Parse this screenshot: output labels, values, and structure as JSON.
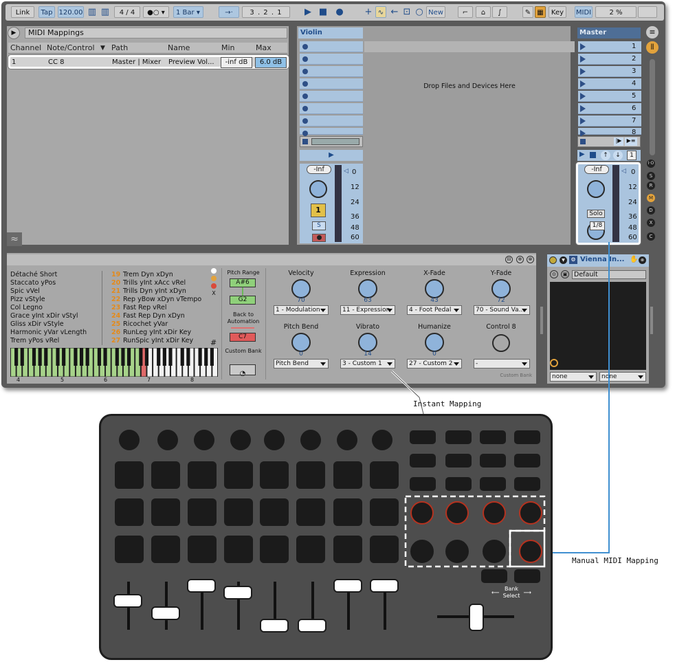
{
  "toolbar": {
    "link": "Link",
    "tap": "Tap",
    "tempo": "120.00",
    "signature": "4 / 4",
    "quantize": "1 Bar",
    "position": "3 .  2 .  1",
    "new": "New",
    "key": "Key",
    "midi": "MIDI",
    "cpu": "2 %"
  },
  "mappings": {
    "title": "MIDI Mappings",
    "columns": [
      "Channel",
      "Note/Control",
      "Path",
      "Name",
      "Min",
      "Max"
    ],
    "row": {
      "channel": "1",
      "control": "CC 8",
      "path": "Master | Mixer",
      "name": "Preview Vol...",
      "min": "-inf dB",
      "max": "6.0 dB"
    }
  },
  "violin": {
    "name": "Violin",
    "volume": "-Inf",
    "track_num": "1",
    "solo": "S",
    "db_scale": [
      "0",
      "12",
      "24",
      "36",
      "48",
      "60"
    ]
  },
  "drop_text": "Drop Files and Devices Here",
  "master": {
    "name": "Master",
    "scenes": [
      "1",
      "2",
      "3",
      "4",
      "5",
      "6",
      "7",
      "8"
    ],
    "volume": "-Inf",
    "solo": "Solo",
    "cue": "1/8",
    "io": "1",
    "db_scale": [
      "0",
      "12",
      "24",
      "36",
      "48",
      "60"
    ]
  },
  "side_letters": [
    "I·O",
    "S",
    "R",
    "M",
    "D",
    "X",
    "C"
  ],
  "articulations": {
    "left": [
      "Détaché Short",
      "Staccato yPos",
      "Spic vVel",
      "Pizz vStyle",
      "Col Legno",
      "Grace yInt xDir vStyl",
      "Gliss xDir vStyle",
      "Harmonic yVar vLength",
      "Trem yPos vRel"
    ],
    "right": [
      {
        "n": "19",
        "t": "Trem Dyn xDyn"
      },
      {
        "n": "20",
        "t": "Trills yInt xAcc vRel"
      },
      {
        "n": "21",
        "t": "Trills Dyn yInt xDyn"
      },
      {
        "n": "22",
        "t": "Rep yBow xDyn vTempo"
      },
      {
        "n": "23",
        "t": "Fast Rep vRel"
      },
      {
        "n": "24",
        "t": "Fast Rep Dyn xDyn"
      },
      {
        "n": "25",
        "t": "Ricochet yVar"
      },
      {
        "n": "26",
        "t": "RunLeg yInt xDir Key"
      },
      {
        "n": "27",
        "t": "RunSpic yInt xDir Key"
      }
    ],
    "x_mark": "X",
    "sharp": "#",
    "octaves": [
      "4",
      "5",
      "6",
      "7",
      "8"
    ]
  },
  "pitch": {
    "label": "Pitch Range",
    "high": "A#6",
    "low": "G2",
    "back": "Back to Automation",
    "note": "C7",
    "bank": "Custom Bank"
  },
  "macros": [
    {
      "label": "Velocity",
      "value": "70",
      "dd": "1 - Modulation"
    },
    {
      "label": "Expression",
      "value": "63",
      "dd": "11 - Expression"
    },
    {
      "label": "X-Fade",
      "value": "43",
      "dd": "4 - Foot Pedal"
    },
    {
      "label": "Y-Fade",
      "value": "72",
      "dd": "70 - Sound Va..."
    },
    {
      "label": "Pitch Bend",
      "value": "0",
      "dd": "Pitch Bend"
    },
    {
      "label": "Vibrato",
      "value": "14",
      "dd": "3 - Custom 1"
    },
    {
      "label": "Humanize",
      "value": "0",
      "dd": "27 - Custom 2"
    },
    {
      "label": "Control 8",
      "value": "",
      "dd": "-"
    }
  ],
  "custom_bank": "Custom Bank",
  "plugin": {
    "name": "Vienna In...",
    "preset": "Default",
    "dd1": "none",
    "dd2": "none"
  },
  "annotations": {
    "instant": "Instant Mapping",
    "manual": "Manual MIDI Mapping",
    "bank_select": "Bank Select"
  },
  "colors": {
    "accent": "#aac4de",
    "highlight": "#8fc0e6",
    "orange": "#e48a1a",
    "red_knob": "#b5321f",
    "mapping_line": "#3f8fd0"
  }
}
